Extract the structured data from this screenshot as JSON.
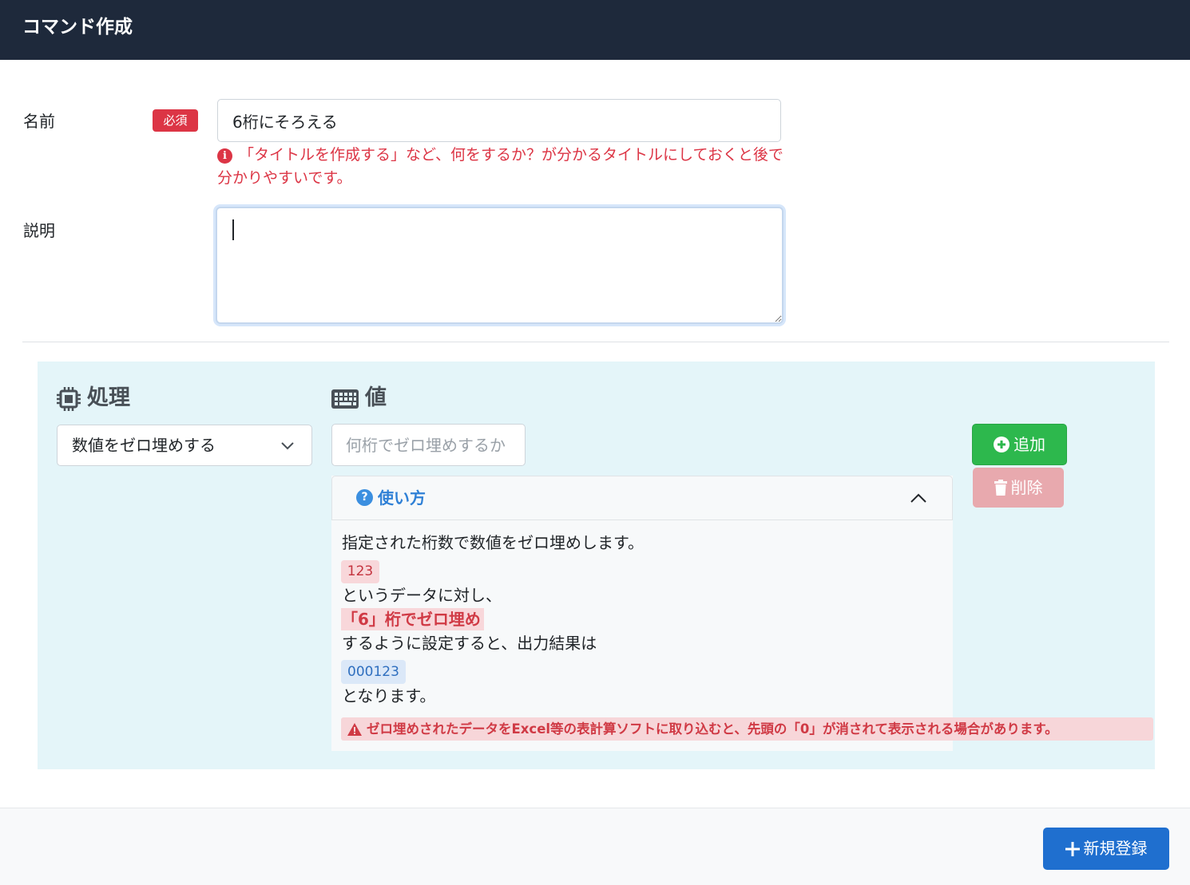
{
  "header": {
    "title": "コマンド作成"
  },
  "form": {
    "name_label": "名前",
    "required_badge": "必須",
    "name_value": "6桁にそろえる",
    "name_hint": "「タイトルを作成する」など、何をするか？が分かるタイトルにしておくと後で分かりやすいです。",
    "description_label": "説明",
    "description_value": ""
  },
  "command": {
    "operation_heading": "処理",
    "value_heading": "値",
    "operation_selected": "数値をゼロ埋めする",
    "value_placeholder": "何桁でゼロ埋めするか",
    "add_label": "追加",
    "delete_label": "削除"
  },
  "usage": {
    "title": "使い方",
    "line1": "指定された桁数で数値をゼロ埋めします。",
    "input_example": "123",
    "line2": "というデータに対し、",
    "emphasis": "「6」桁でゼロ埋め",
    "line3": "するように設定すると、出力結果は",
    "output_example": "000123",
    "line4": "となります。",
    "warning": "ゼロ埋めされたデータをExcel等の表計算ソフトに取り込むと、先頭の「0」が消されて表示される場合があります。"
  },
  "footer": {
    "register_label": "新規登録"
  },
  "colors": {
    "header_bg": "#1e293b",
    "danger": "#dc3545",
    "success": "#2db84d",
    "primary": "#1f6fcf",
    "panel_bg": "#e4f5f9"
  },
  "icons": [
    "cpu-icon",
    "keyboard-icon",
    "chevron-down-icon",
    "info-icon",
    "question-icon",
    "chevron-up-icon",
    "plus-circle-icon",
    "trash-icon",
    "warning-icon",
    "plus-icon"
  ]
}
